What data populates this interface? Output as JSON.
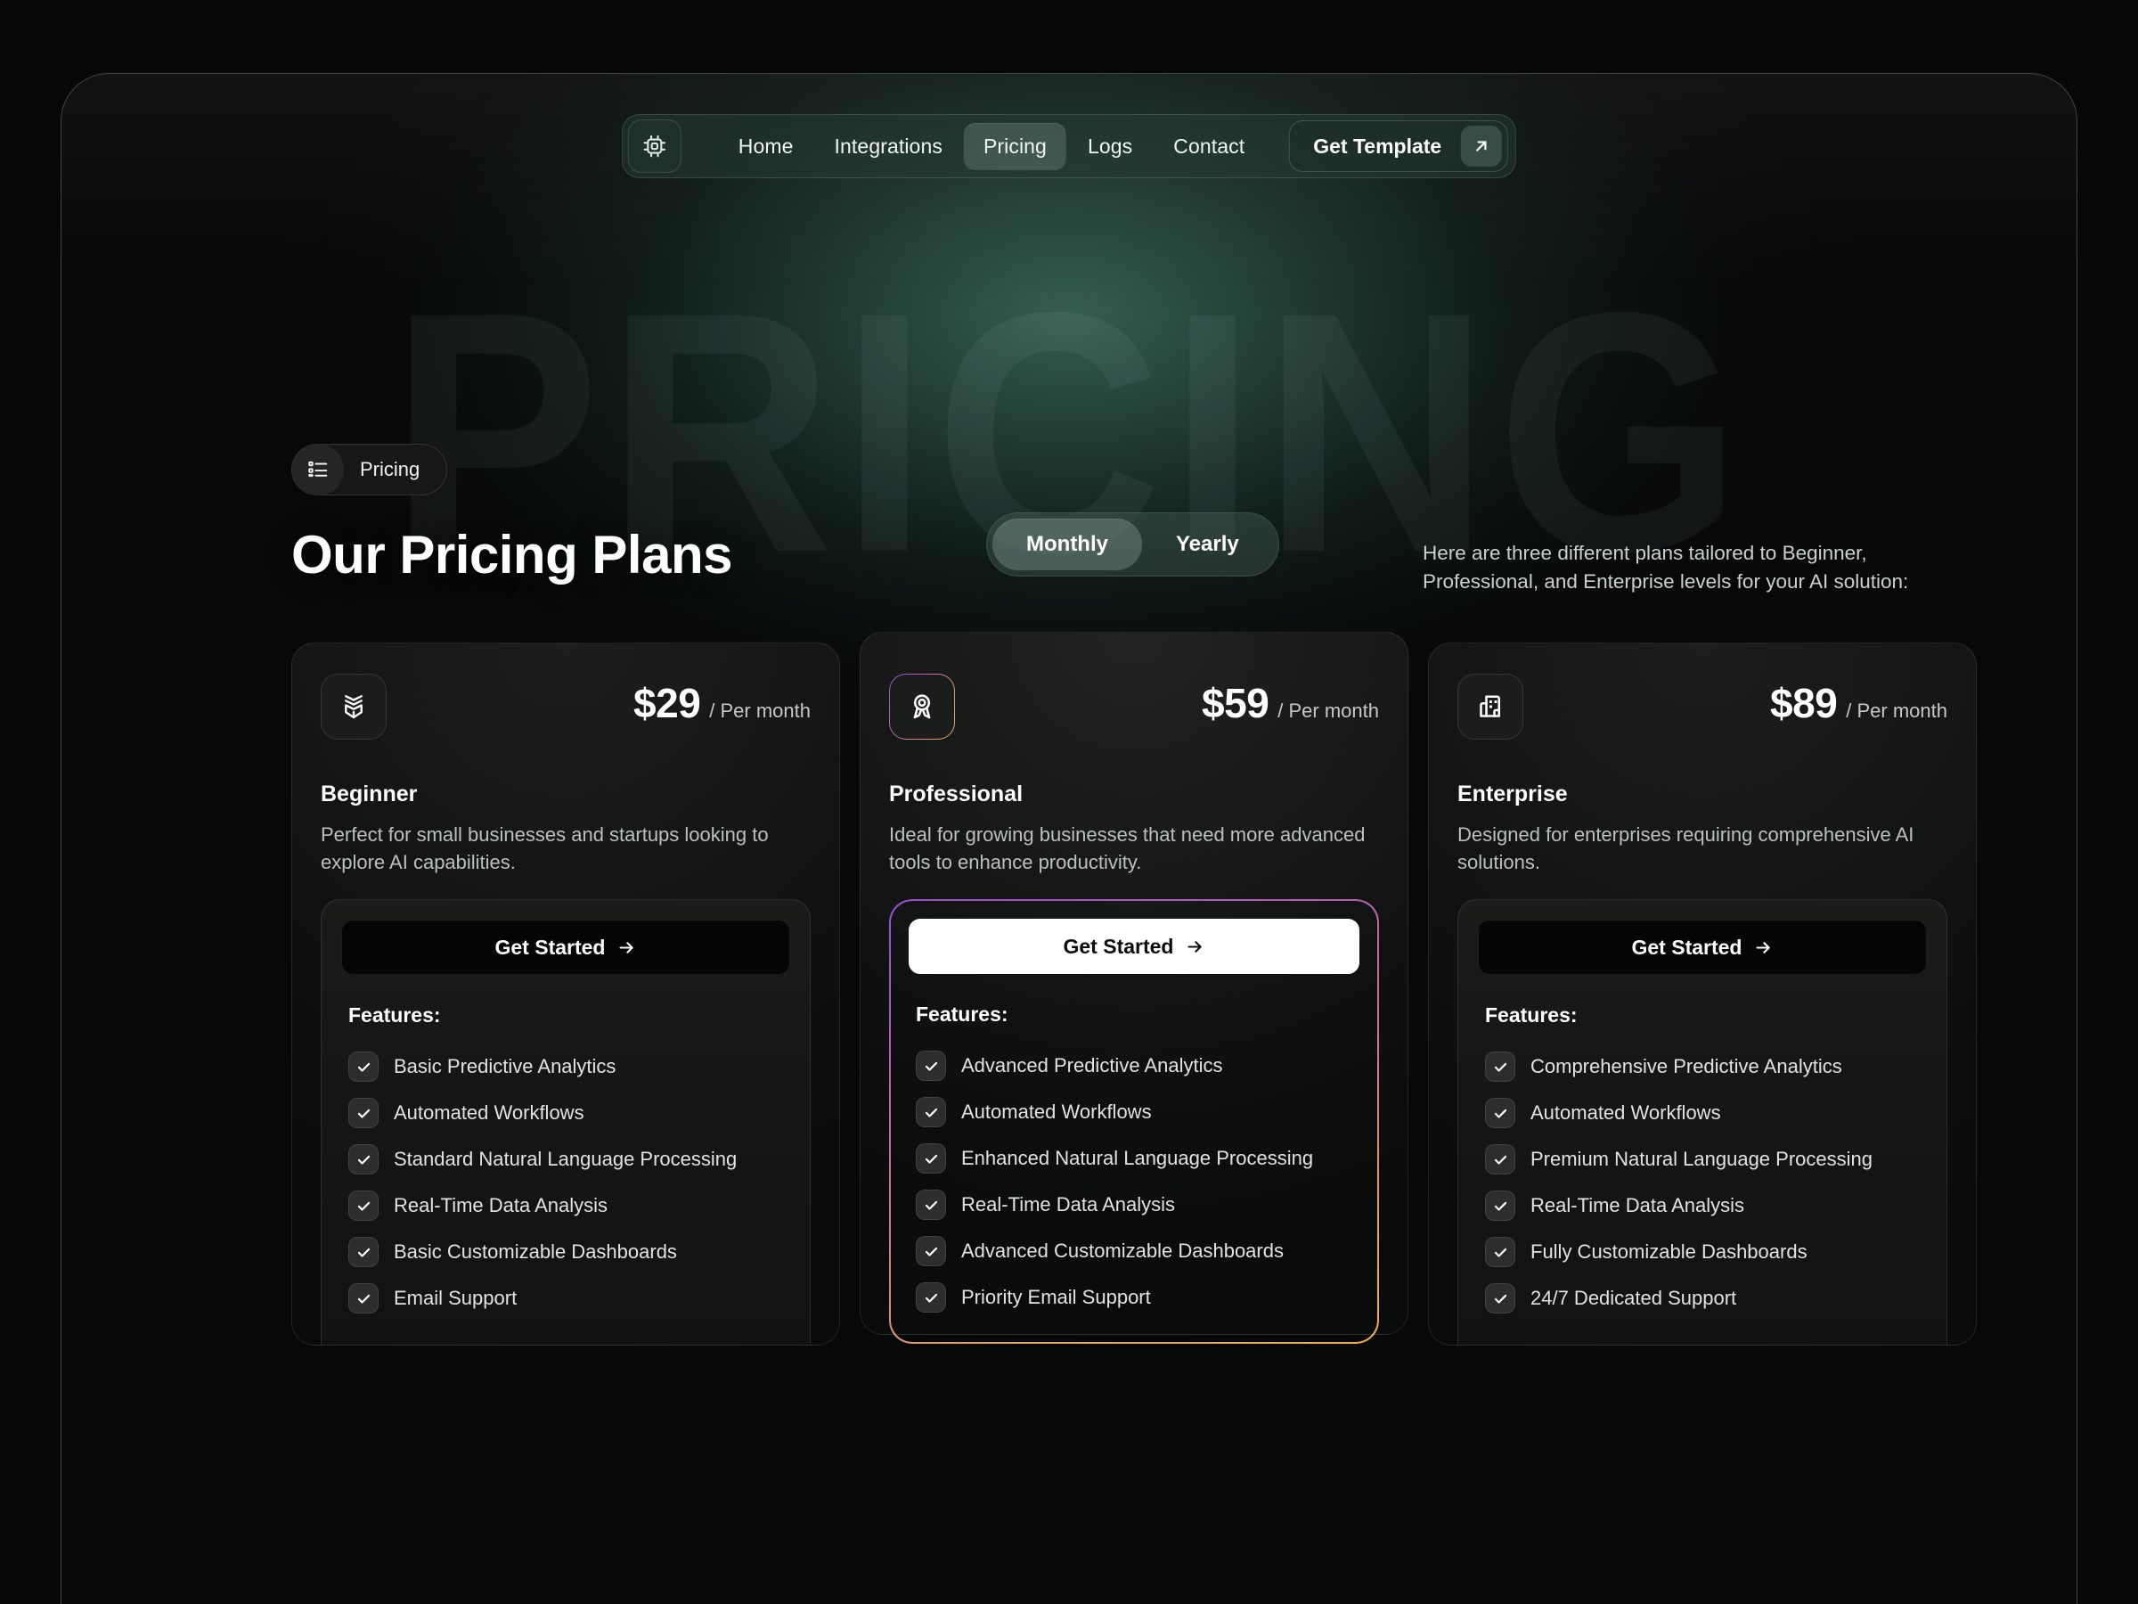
{
  "watermark": "PRICING",
  "nav": {
    "logo_icon": "cpu-chip-icon",
    "links": [
      {
        "label": "Home",
        "active": false
      },
      {
        "label": "Integrations",
        "active": false
      },
      {
        "label": "Pricing",
        "active": true
      },
      {
        "label": "Logs",
        "active": false
      },
      {
        "label": "Contact",
        "active": false
      }
    ],
    "cta_label": "Get Template",
    "cta_icon": "arrow-up-right-icon"
  },
  "header": {
    "badge_label": "Pricing",
    "badge_icon": "list-icon",
    "title": "Our Pricing Plans",
    "description": "Here are three different plans tailored to Beginner, Professional, and Enterprise levels for your AI solution:",
    "billing_toggle": {
      "options": [
        "Monthly",
        "Yearly"
      ],
      "selected": "Monthly"
    }
  },
  "plans": [
    {
      "icon": "sprout-package-icon",
      "price": "$29",
      "period": "/ Per month",
      "name": "Beginner",
      "description": "Perfect for small businesses and startups looking to explore AI capabilities.",
      "cta_label": "Get Started",
      "cta_icon": "arrow-right-icon",
      "features_title": "Features:",
      "featured": false,
      "features": [
        "Basic Predictive Analytics",
        "Automated Workflows",
        "Standard Natural Language Processing",
        "Real-Time Data Analysis",
        "Basic Customizable Dashboards",
        "Email Support"
      ]
    },
    {
      "icon": "award-medal-icon",
      "price": "$59",
      "period": "/ Per month",
      "name": "Professional",
      "description": "Ideal for growing businesses that need more advanced tools to enhance productivity.",
      "cta_label": "Get Started",
      "cta_icon": "arrow-right-icon",
      "features_title": "Features:",
      "featured": true,
      "features": [
        "Advanced Predictive Analytics",
        "Automated Workflows",
        "Enhanced Natural Language Processing",
        "Real-Time Data Analysis",
        "Advanced Customizable Dashboards",
        "Priority Email Support"
      ]
    },
    {
      "icon": "building-icon",
      "price": "$89",
      "period": "/ Per month",
      "name": "Enterprise",
      "description": "Designed for enterprises requiring comprehensive AI solutions.",
      "cta_label": "Get Started",
      "cta_icon": "arrow-right-icon",
      "features_title": "Features:",
      "featured": false,
      "features": [
        "Comprehensive Predictive Analytics",
        "Automated Workflows",
        "Premium Natural Language Processing",
        "Real-Time Data Analysis",
        "Fully Customizable Dashboards",
        "24/7 Dedicated Support"
      ]
    }
  ],
  "colors": {
    "page_background": "#060707",
    "glow_green": "#3c6e5f",
    "featured_gradient_start": "#9a4fd2",
    "featured_gradient_end": "#eeae45",
    "cta_light": "#ffffff"
  }
}
